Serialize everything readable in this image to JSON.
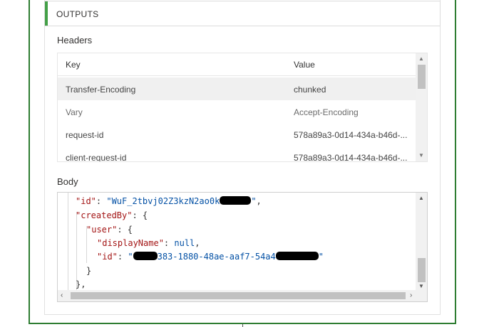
{
  "outputs": {
    "title": "OUTPUTS"
  },
  "headers": {
    "label": "Headers",
    "columns": {
      "key": "Key",
      "value": "Value"
    },
    "rows": [
      {
        "key": "Transfer-Encoding",
        "value": "chunked"
      },
      {
        "key": "Vary",
        "value": "Accept-Encoding"
      },
      {
        "key": "request-id",
        "value": "578a89a3-0d14-434a-b46d-..."
      },
      {
        "key": "client-request-id",
        "value": "578a89a3-0d14-434a-b46d-..."
      }
    ]
  },
  "body": {
    "label": "Body",
    "json": {
      "id_key": "\"id\"",
      "id_value": "\"WuF_2tbvj02Z3kzN2ao0k",
      "id_value_end": "\"",
      "createdBy_key": "\"createdBy\"",
      "user_key": "\"user\"",
      "displayName_key": "\"displayName\"",
      "displayName_value": "null",
      "user_id_key": "\"id\"",
      "user_id_value_start": "\"",
      "user_id_value_mid": "383-1880-48ae-aaf7-54a4",
      "user_id_value_end": "\""
    }
  },
  "icons": {
    "scroll_up": "▲",
    "scroll_down": "▼",
    "scroll_left": "‹",
    "scroll_right": "›"
  },
  "colors": {
    "accent": "#43a047",
    "frame": "#2e7d32",
    "json_key": "#a31515",
    "json_value": "#0451a5"
  }
}
